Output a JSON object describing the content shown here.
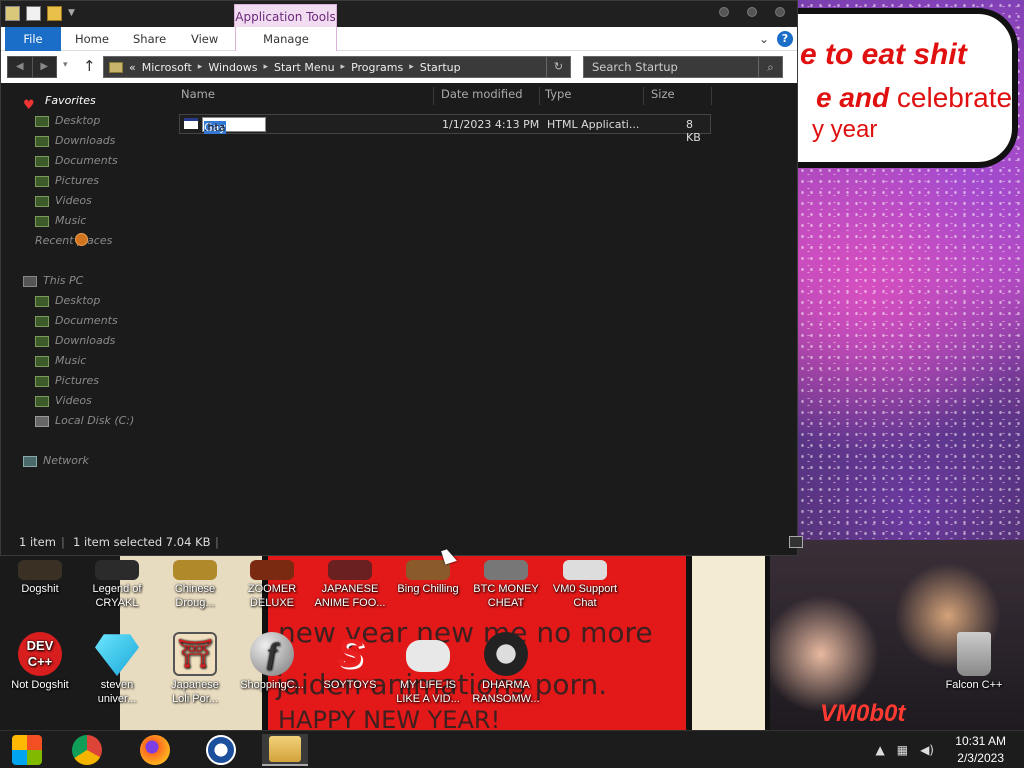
{
  "window": {
    "context_tab": "Application Tools",
    "tabs": {
      "file": "File",
      "home": "Home",
      "share": "Share",
      "view": "View",
      "manage": "Manage"
    },
    "help": "?",
    "address": {
      "prefix": "«",
      "crumbs": [
        "Microsoft",
        "Windows",
        "Start Menu",
        "Programs",
        "Startup"
      ]
    },
    "search_placeholder": "Search Startup",
    "nav": {
      "favorites": "Favorites",
      "fav_items": [
        "Desktop",
        "Downloads",
        "Documents",
        "Pictures",
        "Videos",
        "Music",
        "Recent places"
      ],
      "this_pc": "This PC",
      "pc_items": [
        "Desktop",
        "Documents",
        "Downloads",
        "Music",
        "Pictures",
        "Videos",
        "Local Disk (C:)"
      ],
      "network": "Network"
    },
    "columns": [
      "Name",
      "Date modified",
      "Type",
      "Size"
    ],
    "file": {
      "rename_selected": "Gay",
      "rename_rest": ".hta",
      "date": "1/1/2023 4:13 PM",
      "type": "HTML Applicati...",
      "size": "8 KB"
    },
    "status": {
      "items": "1 item",
      "selected": "1 item selected  7.04 KB"
    }
  },
  "desktop": {
    "icons_row1": [
      {
        "label1": "Dogshit",
        "label2": ""
      },
      {
        "label1": "Legend of",
        "label2": "CRYAKL"
      },
      {
        "label1": "Chinese",
        "label2": "Droug..."
      },
      {
        "label1": "ZOOMER",
        "label2": "DELUXE"
      },
      {
        "label1": "JAPANESE",
        "label2": "ANIME FOO..."
      },
      {
        "label1": "Bing Chilling",
        "label2": ""
      },
      {
        "label1": "BTC MONEY",
        "label2": "CHEAT"
      },
      {
        "label1": "VM0 Support",
        "label2": "Chat"
      }
    ],
    "icons_row2": [
      {
        "label1": "Not Dogshit",
        "label2": "",
        "badge": "DEV\nC++"
      },
      {
        "label1": "steven",
        "label2": "univer..."
      },
      {
        "label1": "Japanese",
        "label2": "Loli Por..."
      },
      {
        "label1": "ShoppingC...",
        "label2": ""
      },
      {
        "label1": "SOYTOYS",
        "label2": ""
      },
      {
        "label1": "MY LIFE IS",
        "label2": "LIKE A VID..."
      },
      {
        "label1": "DHARMA",
        "label2": "RANSOMW..."
      },
      {
        "label1": "Falcon C++",
        "label2": ""
      }
    ],
    "wallpaper_text": {
      "bubble1": "e to eat shit",
      "bubble2a": "e and",
      "bubble2b": "celebrate",
      "bubble3": "y year",
      "red1": "new year new me no more",
      "red2": "jaiden animations porn.",
      "red3": "HAPPY  NEW YEAR!",
      "watermark": "VM0b0t"
    }
  },
  "taskbar": {
    "tray_up": "▲",
    "time": "10:31 AM",
    "date": "2/3/2023"
  }
}
